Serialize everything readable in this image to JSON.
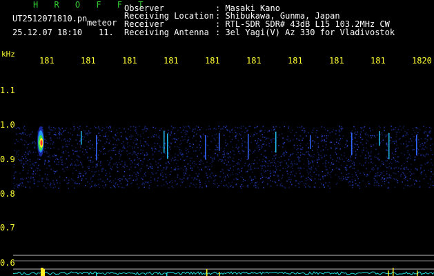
{
  "header": {
    "title": "H R O F F T",
    "filename": "UT2512071810.pn",
    "meteor_label": "meteor",
    "datetime": "25.12.07 18:10",
    "meteor_count": "11.",
    "fields": [
      {
        "label": "Observer",
        "value": ": Masaki Kano"
      },
      {
        "label": "Receiving Location",
        "value": ": Shibukawa, Gunma, Japan"
      },
      {
        "label": "Receiver",
        "value": ": RTL-SDR SDR# 43dB L15 103.2MHz CW"
      },
      {
        "label": "Receiving Antenna",
        "value": ": 3el Yagi(V) Az 330 for Vladivostok"
      }
    ]
  },
  "axes": {
    "y_unit": "kHz",
    "x_ticks": [
      "181",
      "181",
      "181",
      "181",
      "181",
      "181",
      "181",
      "181",
      "181",
      "1820"
    ],
    "y_ticks": [
      "1.1",
      "1.0",
      "0.9",
      "0.8",
      "0.7",
      "0.6"
    ]
  },
  "colors": {
    "header_green": "#33cc33",
    "text_white": "#ffffff",
    "tick_yellow": "#ffff33",
    "baseline_cyan": "#22dddd"
  }
}
